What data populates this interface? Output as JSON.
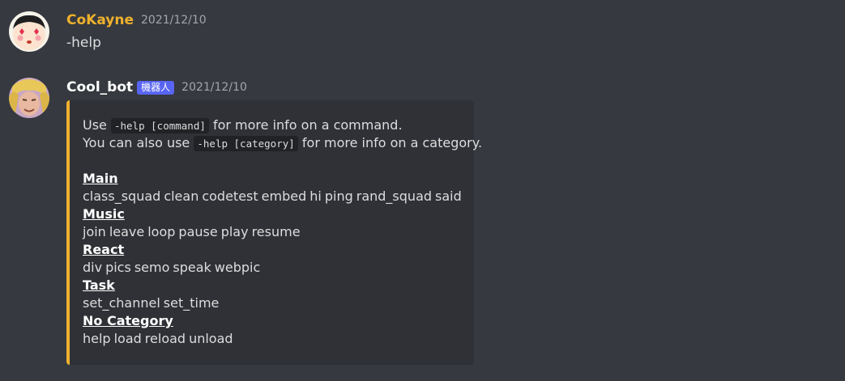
{
  "messages": [
    {
      "username": "CoKayne",
      "username_color": "#f0b12d",
      "timestamp": "2021/12/10",
      "content": "-help",
      "avatar_icon": "cartoon-face-avatar"
    },
    {
      "username": "Cool_bot",
      "username_color": "#ffffff",
      "bot_tag": "機器人",
      "timestamp": "2021/12/10",
      "avatar_icon": "anime-hero-avatar",
      "embed": {
        "accent_color": "#f0b12d",
        "intro_line1_prefix": "Use",
        "intro_line1_code": "-help [command]",
        "intro_line1_suffix": "for more info on a command.",
        "intro_line2_prefix": "You can also use",
        "intro_line2_code": "-help [category]",
        "intro_line2_suffix": "for more info on a category.",
        "categories": [
          {
            "title": "Main",
            "commands": [
              "class_squad",
              "clean",
              "codetest",
              "embed",
              "hi",
              "ping",
              "rand_squad",
              "said"
            ]
          },
          {
            "title": "Music",
            "commands": [
              "join",
              "leave",
              "loop",
              "pause",
              "play",
              "resume"
            ]
          },
          {
            "title": "React",
            "commands": [
              "div",
              "pics",
              "semo",
              "speak",
              "webpic"
            ]
          },
          {
            "title": "Task",
            "commands": [
              "set_channel",
              "set_time"
            ]
          },
          {
            "title": "No Category",
            "commands": [
              "help",
              "load",
              "reload",
              "unload"
            ]
          }
        ]
      }
    }
  ]
}
